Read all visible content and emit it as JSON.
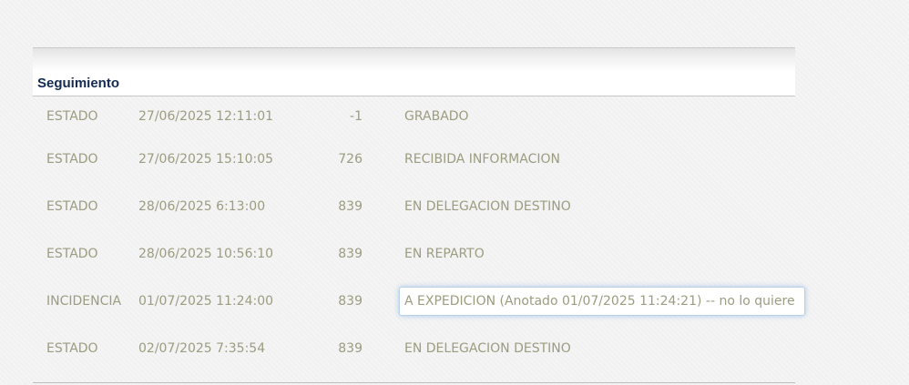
{
  "panel": {
    "title": "Seguimiento"
  },
  "tracking_rows": [
    {
      "type": "ESTADO",
      "datetime": "27/06/2025 12:11:01",
      "code": "-1",
      "description": "GRABADO"
    },
    {
      "type": "ESTADO",
      "datetime": "27/06/2025 15:10:05",
      "code": "726",
      "description": "RECIBIDA INFORMACION"
    },
    {
      "type": "ESTADO",
      "datetime": "28/06/2025 6:13:00",
      "code": "839",
      "description": "EN DELEGACION DESTINO"
    },
    {
      "type": "ESTADO",
      "datetime": "28/06/2025 10:56:10",
      "code": "839",
      "description": "EN REPARTO"
    },
    {
      "type": "INCIDENCIA",
      "datetime": "01/07/2025 11:24:00",
      "code": "839",
      "description": "A EXPEDICION (Anotado 01/07/2025 11:24:21) -- no lo quiere"
    },
    {
      "type": "ESTADO",
      "datetime": "02/07/2025 7:35:54",
      "code": "839",
      "description": "EN DELEGACION DESTINO"
    }
  ],
  "colors": {
    "title": "#142a52",
    "row_text": "#9c9c80",
    "focus_border": "#b7d2ea"
  }
}
